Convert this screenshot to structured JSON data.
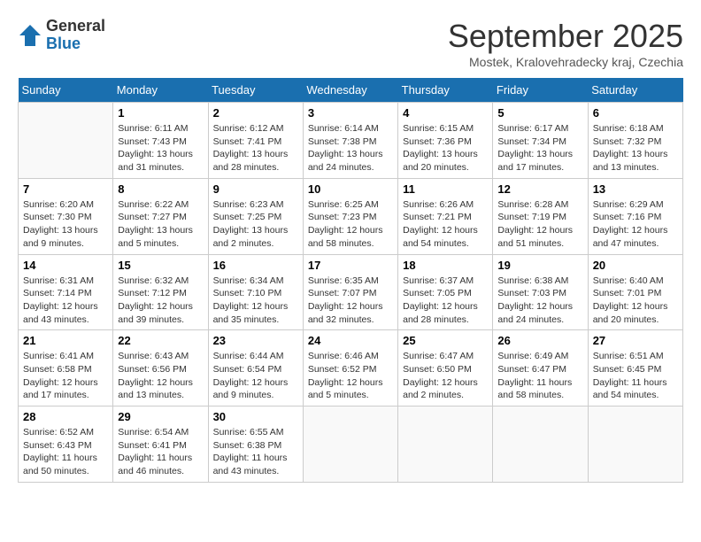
{
  "header": {
    "logo_general": "General",
    "logo_blue": "Blue",
    "month_title": "September 2025",
    "location": "Mostek, Kralovehradecky kraj, Czechia"
  },
  "columns": [
    "Sunday",
    "Monday",
    "Tuesday",
    "Wednesday",
    "Thursday",
    "Friday",
    "Saturday"
  ],
  "weeks": [
    [
      {
        "day": "",
        "info": ""
      },
      {
        "day": "1",
        "info": "Sunrise: 6:11 AM\nSunset: 7:43 PM\nDaylight: 13 hours and 31 minutes."
      },
      {
        "day": "2",
        "info": "Sunrise: 6:12 AM\nSunset: 7:41 PM\nDaylight: 13 hours and 28 minutes."
      },
      {
        "day": "3",
        "info": "Sunrise: 6:14 AM\nSunset: 7:38 PM\nDaylight: 13 hours and 24 minutes."
      },
      {
        "day": "4",
        "info": "Sunrise: 6:15 AM\nSunset: 7:36 PM\nDaylight: 13 hours and 20 minutes."
      },
      {
        "day": "5",
        "info": "Sunrise: 6:17 AM\nSunset: 7:34 PM\nDaylight: 13 hours and 17 minutes."
      },
      {
        "day": "6",
        "info": "Sunrise: 6:18 AM\nSunset: 7:32 PM\nDaylight: 13 hours and 13 minutes."
      }
    ],
    [
      {
        "day": "7",
        "info": "Sunrise: 6:20 AM\nSunset: 7:30 PM\nDaylight: 13 hours and 9 minutes."
      },
      {
        "day": "8",
        "info": "Sunrise: 6:22 AM\nSunset: 7:27 PM\nDaylight: 13 hours and 5 minutes."
      },
      {
        "day": "9",
        "info": "Sunrise: 6:23 AM\nSunset: 7:25 PM\nDaylight: 13 hours and 2 minutes."
      },
      {
        "day": "10",
        "info": "Sunrise: 6:25 AM\nSunset: 7:23 PM\nDaylight: 12 hours and 58 minutes."
      },
      {
        "day": "11",
        "info": "Sunrise: 6:26 AM\nSunset: 7:21 PM\nDaylight: 12 hours and 54 minutes."
      },
      {
        "day": "12",
        "info": "Sunrise: 6:28 AM\nSunset: 7:19 PM\nDaylight: 12 hours and 51 minutes."
      },
      {
        "day": "13",
        "info": "Sunrise: 6:29 AM\nSunset: 7:16 PM\nDaylight: 12 hours and 47 minutes."
      }
    ],
    [
      {
        "day": "14",
        "info": "Sunrise: 6:31 AM\nSunset: 7:14 PM\nDaylight: 12 hours and 43 minutes."
      },
      {
        "day": "15",
        "info": "Sunrise: 6:32 AM\nSunset: 7:12 PM\nDaylight: 12 hours and 39 minutes."
      },
      {
        "day": "16",
        "info": "Sunrise: 6:34 AM\nSunset: 7:10 PM\nDaylight: 12 hours and 35 minutes."
      },
      {
        "day": "17",
        "info": "Sunrise: 6:35 AM\nSunset: 7:07 PM\nDaylight: 12 hours and 32 minutes."
      },
      {
        "day": "18",
        "info": "Sunrise: 6:37 AM\nSunset: 7:05 PM\nDaylight: 12 hours and 28 minutes."
      },
      {
        "day": "19",
        "info": "Sunrise: 6:38 AM\nSunset: 7:03 PM\nDaylight: 12 hours and 24 minutes."
      },
      {
        "day": "20",
        "info": "Sunrise: 6:40 AM\nSunset: 7:01 PM\nDaylight: 12 hours and 20 minutes."
      }
    ],
    [
      {
        "day": "21",
        "info": "Sunrise: 6:41 AM\nSunset: 6:58 PM\nDaylight: 12 hours and 17 minutes."
      },
      {
        "day": "22",
        "info": "Sunrise: 6:43 AM\nSunset: 6:56 PM\nDaylight: 12 hours and 13 minutes."
      },
      {
        "day": "23",
        "info": "Sunrise: 6:44 AM\nSunset: 6:54 PM\nDaylight: 12 hours and 9 minutes."
      },
      {
        "day": "24",
        "info": "Sunrise: 6:46 AM\nSunset: 6:52 PM\nDaylight: 12 hours and 5 minutes."
      },
      {
        "day": "25",
        "info": "Sunrise: 6:47 AM\nSunset: 6:50 PM\nDaylight: 12 hours and 2 minutes."
      },
      {
        "day": "26",
        "info": "Sunrise: 6:49 AM\nSunset: 6:47 PM\nDaylight: 11 hours and 58 minutes."
      },
      {
        "day": "27",
        "info": "Sunrise: 6:51 AM\nSunset: 6:45 PM\nDaylight: 11 hours and 54 minutes."
      }
    ],
    [
      {
        "day": "28",
        "info": "Sunrise: 6:52 AM\nSunset: 6:43 PM\nDaylight: 11 hours and 50 minutes."
      },
      {
        "day": "29",
        "info": "Sunrise: 6:54 AM\nSunset: 6:41 PM\nDaylight: 11 hours and 46 minutes."
      },
      {
        "day": "30",
        "info": "Sunrise: 6:55 AM\nSunset: 6:38 PM\nDaylight: 11 hours and 43 minutes."
      },
      {
        "day": "",
        "info": ""
      },
      {
        "day": "",
        "info": ""
      },
      {
        "day": "",
        "info": ""
      },
      {
        "day": "",
        "info": ""
      }
    ]
  ]
}
